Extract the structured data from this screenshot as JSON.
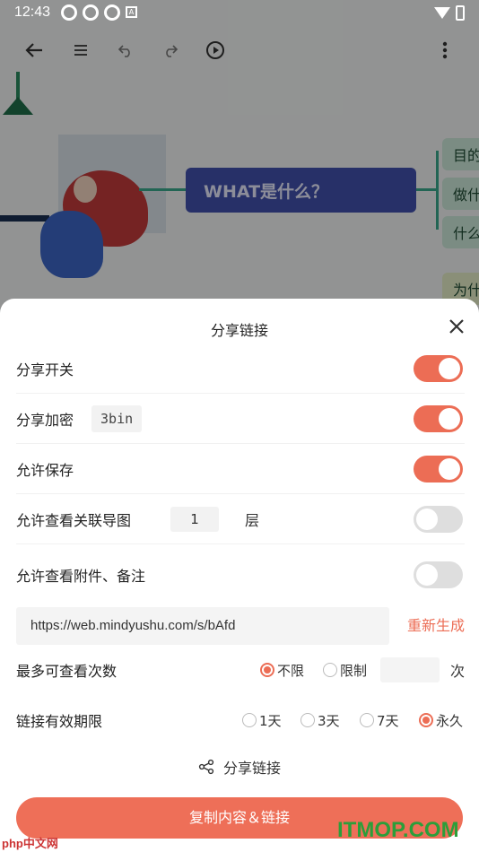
{
  "status_bar": {
    "time": "12:43",
    "badge": "A"
  },
  "toolbar": {
    "icons": [
      "back-arrow-icon",
      "menu-icon",
      "undo-icon",
      "redo-icon",
      "play-icon",
      "more-vert-icon"
    ]
  },
  "mindmap": {
    "central_topic": "WHAT是什么？",
    "branches": [
      "目的",
      "做什",
      "什么",
      "为什"
    ]
  },
  "sheet": {
    "title": "分享链接",
    "close_icon": "×",
    "share_switch": {
      "label": "分享开关",
      "on": true
    },
    "encrypt": {
      "label": "分享加密",
      "password": "3bin",
      "on": true
    },
    "allow_save": {
      "label": "允许保存",
      "on": true
    },
    "related_maps": {
      "label": "允许查看关联导图",
      "layers": "1",
      "unit": "层",
      "on": false
    },
    "attachments": {
      "label": "允许查看附件、备注",
      "on": false
    },
    "url": "https://web.mindyushu.com/s/bAfd",
    "regenerate": "重新生成",
    "max_views": {
      "label": "最多可查看次数",
      "option_unlimited": "不限",
      "option_limited": "限制",
      "value": "",
      "unit": "次",
      "selected": "不限"
    },
    "validity": {
      "label": "链接有效期限",
      "options": [
        "1天",
        "3天",
        "7天",
        "永久"
      ],
      "selected": "永久"
    },
    "share_link_label": "分享链接",
    "copy_button": "复制内容＆链接"
  },
  "watermarks": {
    "left": "php中文网",
    "right": "ITMOP.COM"
  },
  "colors": {
    "accent": "#ec6d55",
    "node": "#4250ad",
    "branch": "#3aa98c"
  }
}
